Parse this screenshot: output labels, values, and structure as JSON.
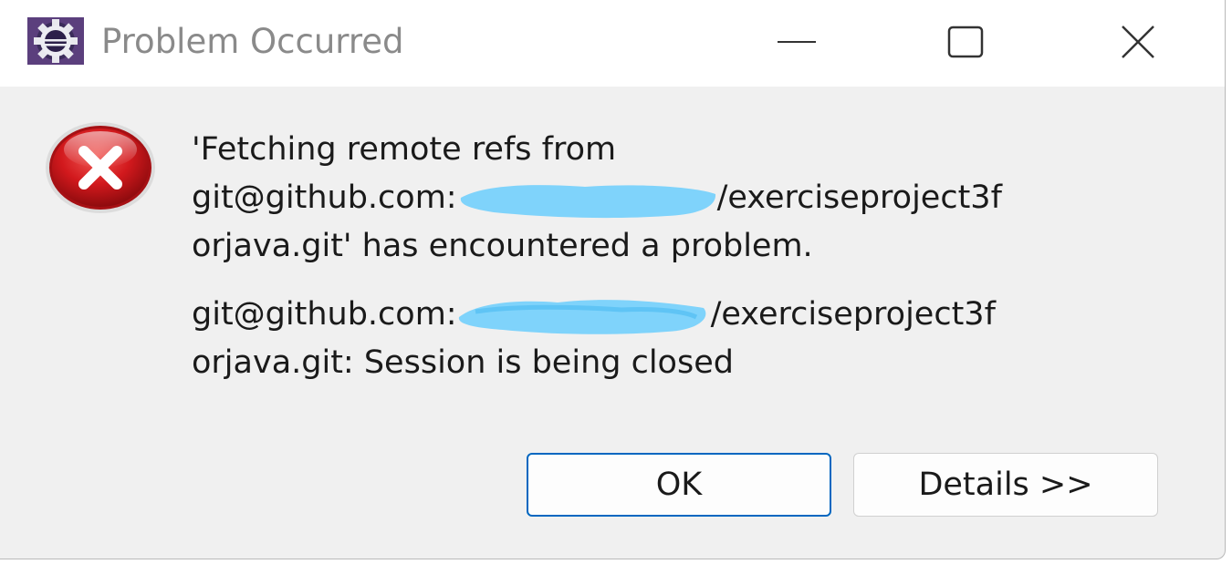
{
  "window": {
    "title": "Problem Occurred",
    "app_icon": "eclipse-icon",
    "controls": {
      "minimize_icon": "minimize-icon",
      "maximize_icon": "maximize-icon",
      "close_icon": "close-icon"
    }
  },
  "message": {
    "icon": "error-icon",
    "line1": "'Fetching remote refs from",
    "line2_prefix": "git@github.com:",
    "line2_suffix": "/exerciseproject3f",
    "line3": "orjava.git' has encountered a problem.",
    "line4_prefix": "git@github.com:",
    "line4_suffix": "/exerciseproject3f",
    "line5": "orjava.git: Session is being closed"
  },
  "buttons": {
    "ok_label": "OK",
    "details_label": "Details >>"
  },
  "colors": {
    "redaction": "#7fd3fb",
    "accent_border": "#0067c0",
    "error_red": "#c8191d",
    "title_text": "#8a8a8a"
  }
}
